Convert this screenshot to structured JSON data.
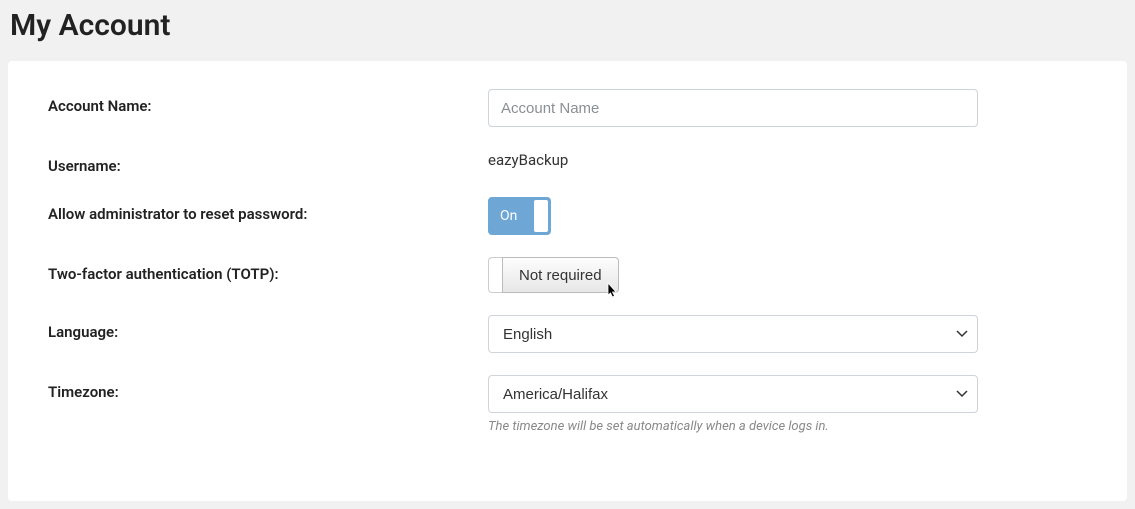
{
  "page": {
    "title": "My Account"
  },
  "form": {
    "accountName": {
      "label": "Account Name:",
      "placeholder": "Account Name",
      "value": ""
    },
    "username": {
      "label": "Username:",
      "value": "eazyBackup"
    },
    "allowReset": {
      "label": "Allow administrator to reset password:",
      "state": "On"
    },
    "totp": {
      "label": "Two-factor authentication (TOTP):",
      "buttonLabel": "Not required"
    },
    "language": {
      "label": "Language:",
      "value": "English"
    },
    "timezone": {
      "label": "Timezone:",
      "value": "America/Halifax",
      "helper": "The timezone will be set automatically when a device logs in."
    }
  }
}
